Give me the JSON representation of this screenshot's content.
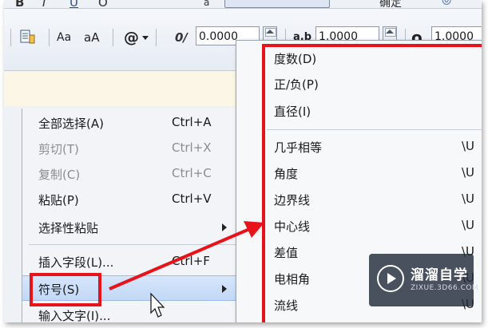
{
  "toolbar": {
    "fragments": [
      "B",
      "I",
      "U",
      "O",
      "a",
      "确定"
    ],
    "aa_small": "Aa",
    "aa_large": "aA",
    "at_symbol": "@",
    "oblique_icon": "0/",
    "oblique_value": "0.0000",
    "tracking_icon": "a.b",
    "tracking_value": "1.0000",
    "width_icon": "o",
    "width_value": "1.0000"
  },
  "context_menu": {
    "items": [
      {
        "label": "全部选择(A)",
        "shortcut": "Ctrl+A",
        "disabled": false
      },
      {
        "label": "剪切(T)",
        "shortcut": "Ctrl+X",
        "disabled": true
      },
      {
        "label": "复制(C)",
        "shortcut": "Ctrl+C",
        "disabled": true
      },
      {
        "label": "粘贴(P)",
        "shortcut": "Ctrl+V",
        "disabled": false
      },
      {
        "label": "选择性粘贴",
        "shortcut": "",
        "disabled": false,
        "submenu": true
      },
      {
        "label": "插入字段(L)...",
        "shortcut": "Ctrl+F",
        "disabled": false
      },
      {
        "label": "符号(S)",
        "shortcut": "",
        "disabled": false,
        "submenu": true,
        "highlighted": true
      },
      {
        "label": "输入文字(I)...",
        "shortcut": "",
        "disabled": false
      }
    ]
  },
  "symbol_menu": {
    "top_items": [
      {
        "label": "度数(D)"
      },
      {
        "label": "正/负(P)"
      },
      {
        "label": "直径(I)"
      }
    ],
    "items": [
      {
        "label": "几乎相等",
        "code": "\\U"
      },
      {
        "label": "角度",
        "code": "\\U"
      },
      {
        "label": "边界线",
        "code": "\\U"
      },
      {
        "label": "中心线",
        "code": "\\U"
      },
      {
        "label": "差值",
        "code": "\\U"
      },
      {
        "label": "电相角",
        "code": "\\U"
      },
      {
        "label": "流线",
        "code": "\\U"
      }
    ]
  },
  "watermark": {
    "name": "溜溜自学",
    "url": "ZIXUE.3D66.COM"
  },
  "colors": {
    "annotation_red": "#e8131a",
    "highlight": "#c2d8f6",
    "editor_bar": "#fbf6e6"
  }
}
